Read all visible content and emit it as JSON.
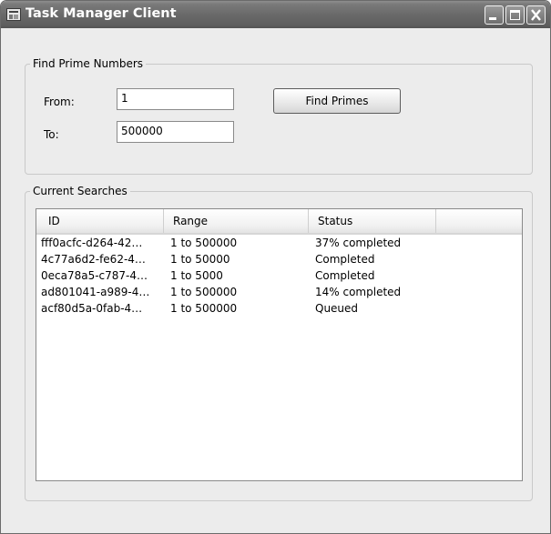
{
  "window": {
    "title": "Task Manager Client"
  },
  "find_group": {
    "legend": "Find Prime Numbers",
    "from_label": "From:",
    "from_value": "1",
    "to_label": "To:",
    "to_value": "500000",
    "button_label": "Find Primes"
  },
  "searches_group": {
    "legend": "Current Searches",
    "columns": [
      "ID",
      "Range",
      "Status"
    ],
    "rows": [
      {
        "id": "fff0acfc-d264-42…",
        "range": "1 to 500000",
        "status": "37% completed"
      },
      {
        "id": "4c77a6d2-fe62-4…",
        "range": "1 to 50000",
        "status": "Completed"
      },
      {
        "id": "0eca78a5-c787-4…",
        "range": "1 to 5000",
        "status": "Completed"
      },
      {
        "id": "ad801041-a989-4…",
        "range": "1 to 500000",
        "status": "14% completed"
      },
      {
        "id": "acf80d5a-0fab-4…",
        "range": "1 to 500000",
        "status": "Queued"
      }
    ]
  }
}
